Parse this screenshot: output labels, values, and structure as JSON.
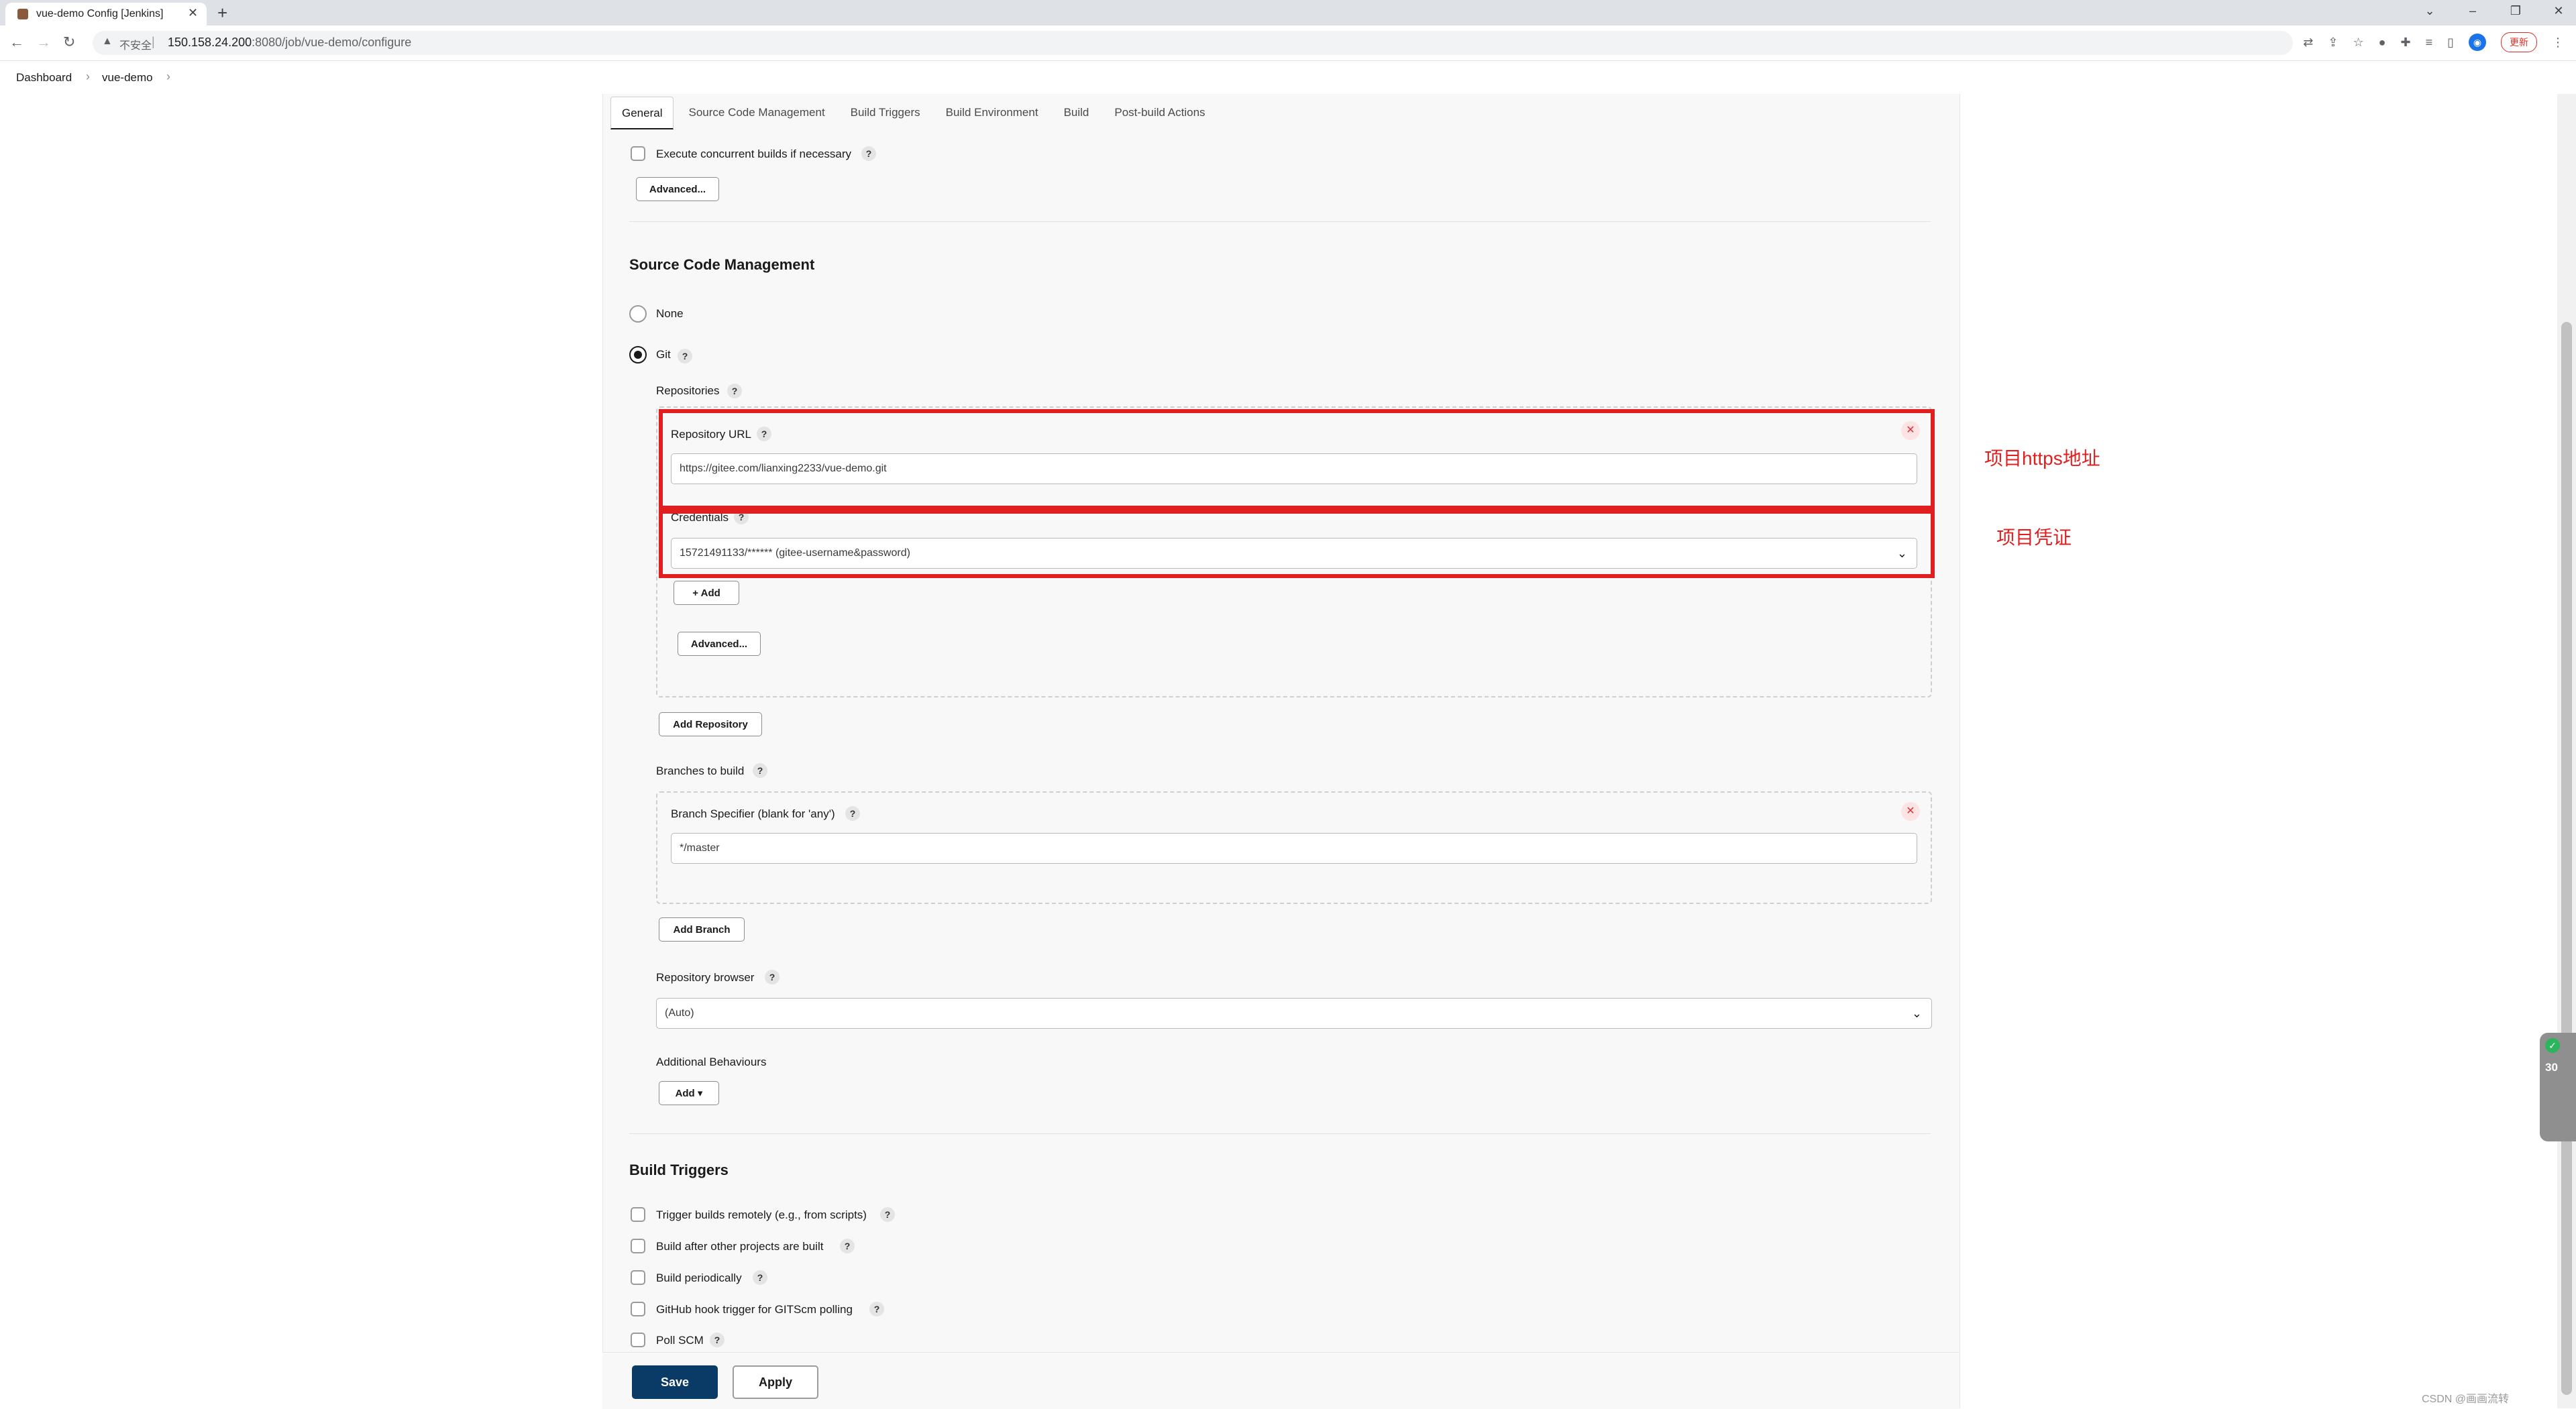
{
  "browser": {
    "tab_title": "vue-demo Config [Jenkins]",
    "tab_close": "✕",
    "new_tab": "+",
    "window_controls": [
      "⌄",
      "–",
      "❐",
      "✕"
    ],
    "insecure_label": "不安全",
    "url_host": "150.158.24.200",
    "url_path": ":8080/job/vue-demo/configure",
    "update_label": "更新"
  },
  "breadcrumb": {
    "items": [
      "Dashboard",
      "vue-demo"
    ],
    "separator": "›"
  },
  "config_tabs": [
    "General",
    "Source Code Management",
    "Build Triggers",
    "Build Environment",
    "Build",
    "Post-build Actions"
  ],
  "general": {
    "concurrent_label": "Execute concurrent builds if necessary",
    "advanced_label": "Advanced..."
  },
  "scm": {
    "title": "Source Code Management",
    "options": [
      "None",
      "Git"
    ],
    "selected": "Git",
    "repositories_label": "Repositories",
    "repo_url_label": "Repository URL",
    "repo_url_value": "https://gitee.com/lianxing2233/vue-demo.git",
    "credentials_label": "Credentials",
    "credentials_value": "15721491133/****** (gitee-username&password)",
    "add_label": "+ Add",
    "advanced_label": "Advanced...",
    "add_repository_label": "Add Repository",
    "branches_label": "Branches to build",
    "branch_specifier_label": "Branch Specifier (blank for 'any')",
    "branch_specifier_value": "*/master",
    "add_branch_label": "Add Branch",
    "repo_browser_label": "Repository browser",
    "repo_browser_value": "(Auto)",
    "additional_behaviours_label": "Additional Behaviours",
    "add_dropdown_label": "Add ▾"
  },
  "build_triggers": {
    "title": "Build Triggers",
    "items": [
      "Trigger builds remotely (e.g., from scripts)",
      "Build after other projects are built",
      "Build periodically",
      "GitHub hook trigger for GITScm polling",
      "Poll SCM"
    ]
  },
  "annotations": {
    "repo_url_note": "项目https地址",
    "credentials_note": "项目凭证",
    "annotation_color": "#e02020"
  },
  "footer": {
    "save_label": "Save",
    "apply_label": "Apply"
  },
  "widget_value": "30",
  "watermark": "CSDN @画画流转",
  "help_glyph": "?",
  "delete_glyph": "✕",
  "chevron_glyph": "⌄",
  "colors": {
    "save_button": "#0a3a66",
    "panel_bg": "#f8f8f8",
    "annotation_red": "#e02020"
  }
}
